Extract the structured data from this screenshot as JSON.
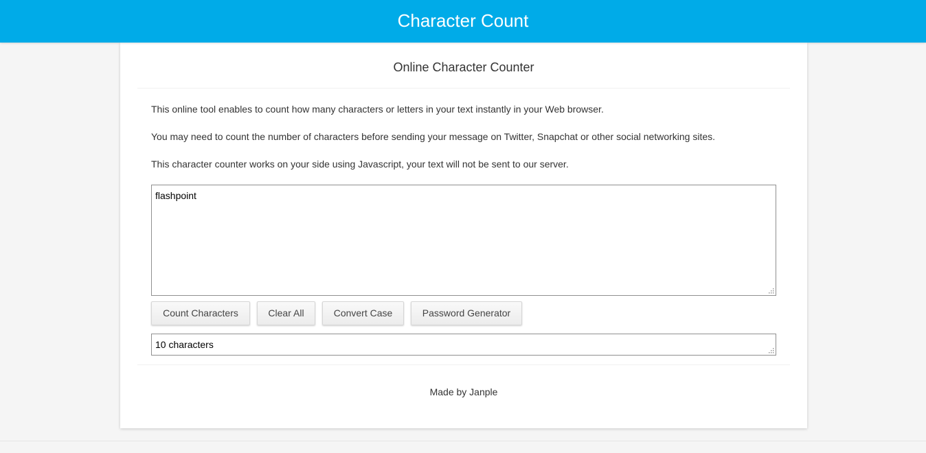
{
  "header": {
    "title": "Character Count"
  },
  "card": {
    "heading": "Online Character Counter",
    "paragraphs": [
      "This online tool enables to count how many characters or letters in your text instantly in your Web browser.",
      "You may need to count the number of characters before sending your message on Twitter, Snapchat or other social networking sites.",
      "This character counter works on your side using Javascript, your text will not be sent to our server."
    ],
    "input_text": "flashpoint",
    "buttons": {
      "count": "Count Characters",
      "clear": "Clear All",
      "convert": "Convert Case",
      "password": "Password Generator"
    },
    "result_text": "10 characters",
    "footer": "Made by Janple"
  },
  "colors": {
    "header_bg": "#00abe8",
    "page_bg": "#f5f5f5",
    "card_bg": "#ffffff"
  },
  "icons": {
    "resize_grip": "resize-grip-icon"
  }
}
